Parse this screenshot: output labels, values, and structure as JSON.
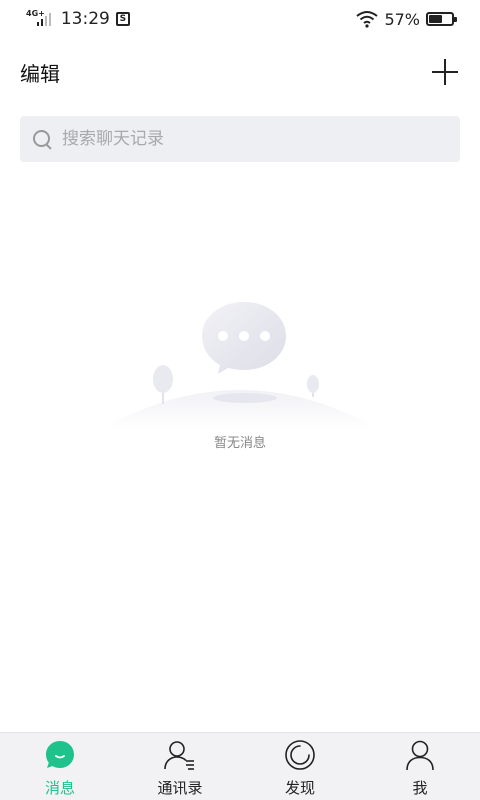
{
  "status_bar": {
    "network": "4G+",
    "time": "13:29",
    "notification_glyph": "S",
    "battery_percent": "57%",
    "battery_level": 0.57
  },
  "header": {
    "edit_label": "编辑",
    "add_icon": "plus-icon"
  },
  "search": {
    "placeholder": "搜索聊天记录",
    "icon": "search-icon"
  },
  "empty_state": {
    "message": "暂无消息",
    "illustration": "chat-bubble-on-hill"
  },
  "tabs": [
    {
      "label": "消息",
      "icon": "message-icon",
      "active": true
    },
    {
      "label": "通讯录",
      "icon": "contacts-icon",
      "active": false
    },
    {
      "label": "发现",
      "icon": "discover-icon",
      "active": false
    },
    {
      "label": "我",
      "icon": "profile-icon",
      "active": false
    }
  ],
  "colors": {
    "accent": "#1fc28a",
    "search_bg": "#eeeff2",
    "tabbar_bg": "#f2f2f4"
  }
}
